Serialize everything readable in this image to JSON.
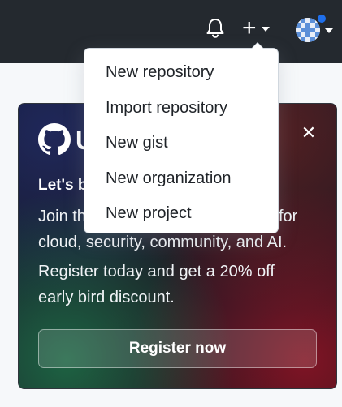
{
  "header": {
    "notifications_icon": "bell-icon",
    "create_icon": "plus-icon",
    "create_caret_icon": "caret-down-icon",
    "avatar_icon": "avatar",
    "avatar_caret_icon": "caret-down-icon",
    "status_dot_color": "#1f6feb",
    "background_color": "#24292f"
  },
  "create_menu": {
    "items": [
      {
        "label": "New repository"
      },
      {
        "label": "Import repository"
      },
      {
        "label": "New gist"
      },
      {
        "label": "New organization"
      },
      {
        "label": "New project"
      }
    ]
  },
  "promo": {
    "logo_icon": "github-mark-icon",
    "logo_text": "U",
    "close_icon": "close-icon",
    "close_glyph": "✕",
    "heading": "Let's b",
    "lines": [
      "Join th",
      "for",
      "cloud, security, community, and AI.",
      "Register today and get a 20% off",
      "early bird discount."
    ],
    "cta_label": "Register now"
  }
}
